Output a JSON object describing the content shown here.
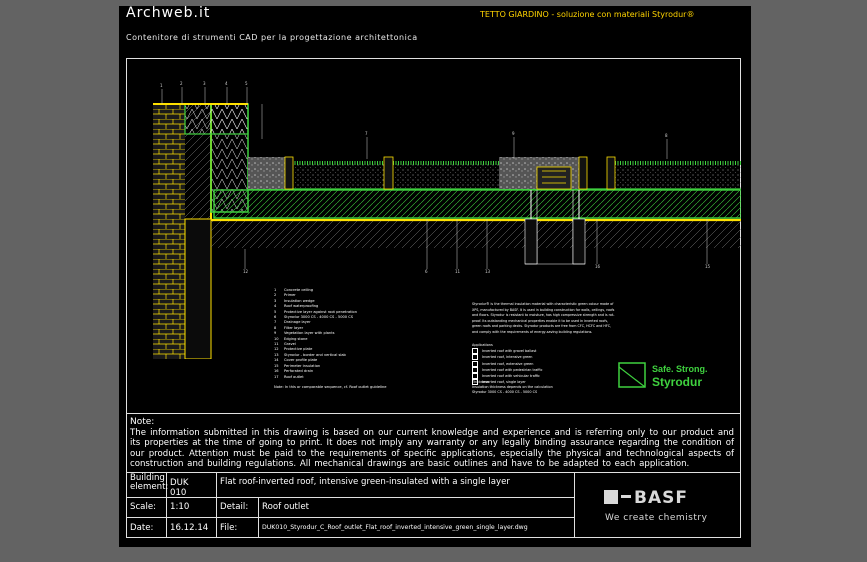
{
  "header": {
    "brand": "Archweb.it",
    "title": "TETTO GIARDINO - soluzione con materiali Styrodur®",
    "subtitle": "Contenitore di strumenti CAD per la progettazione architettonica"
  },
  "legend": {
    "items": [
      {
        "num": "1",
        "label": "Concrete ceiling"
      },
      {
        "num": "2",
        "label": "Primer"
      },
      {
        "num": "3",
        "label": "Insulation wedge"
      },
      {
        "num": "4",
        "label": "Roof waterproofing"
      },
      {
        "num": "5",
        "label": "Protective layer against root penetration"
      },
      {
        "num": "6",
        "label": "Styrodur 3000 CS - 4000 CS - 5000 CS"
      },
      {
        "num": "7",
        "label": "Drainage layer"
      },
      {
        "num": "8",
        "label": "Filter layer"
      },
      {
        "num": "9",
        "label": "Vegetation layer with plants"
      },
      {
        "num": "10",
        "label": "Edging stone"
      },
      {
        "num": "11",
        "label": "Gravel"
      },
      {
        "num": "12",
        "label": "Protective plate"
      },
      {
        "num": "13",
        "label": "Styrodur - border and vertical slab"
      },
      {
        "num": "14",
        "label": "Cover profile plate"
      },
      {
        "num": "15",
        "label": "Perimeter insulation"
      },
      {
        "num": "16",
        "label": "Perforated drain"
      },
      {
        "num": "17",
        "label": "Roof outlet"
      }
    ],
    "footnote": "Note: In this or comparable sequence, cf. Roof outlet guideline"
  },
  "info": {
    "paragraph": "Styrodur® is the thermal insulation material with characteristic green colour made of XPS, manufactured by BASF. It is used in building construction for walls, ceilings, roofs and floors. Styrodur is resistant to moisture, has high compressive strength and is rot-proof. Its outstanding mechanical properties enable it to be used in inverted roofs, green roofs and parking decks. Styrodur products are free from CFC, HCFC and HFC, and comply with the requirements of energy-saving building regulations.",
    "app_heading": "Applications",
    "applications": [
      "Inverted roof with gravel ballast",
      "Inverted roof, intensive green",
      "Inverted roof, extensive green",
      "Inverted roof with pedestrian traffic",
      "Inverted roof with vehicular traffic",
      "Inverted roof, single layer"
    ],
    "thickness_heading": "Thickness",
    "thickness_lines": [
      "Insulation thickness depends on the calculation",
      "Styrodur 3000 CS - 4000 CS - 5000 CS"
    ]
  },
  "styrodur_logo": {
    "tagline": "Safe. Strong.",
    "name": "Styrodur"
  },
  "note": {
    "heading": "Note:",
    "text": "The information submitted in this drawing is based on our current knowledge and experience and is referring only to our product and its properties at the time of going to print. It does not imply any warranty or any legally binding assurance regarding the condition of our product. Attention must be paid to the requirements of specific applications, especially the physical and technological aspects of construction and building regulations. All mechanical drawings are basic outlines and have to be adapted to each application."
  },
  "titleblock": {
    "building_element_label": "Building element:",
    "building_element_value": "DUK 010",
    "description": "Flat roof-inverted roof, intensive green-insulated with a single layer",
    "scale_label": "Scale:",
    "scale_value": "1:10",
    "detail_label": "Detail:",
    "detail_value": "Roof outlet",
    "date_label": "Date:",
    "date_value": "16.12.14",
    "file_label": "File:",
    "file_value": "DUK010_Styrodur_C_Roof_outlet_Flat_roof_inverted_intensive_green_single_layer.dwg"
  },
  "basf": {
    "logo": "BASF",
    "tagline": "We create chemistry"
  }
}
